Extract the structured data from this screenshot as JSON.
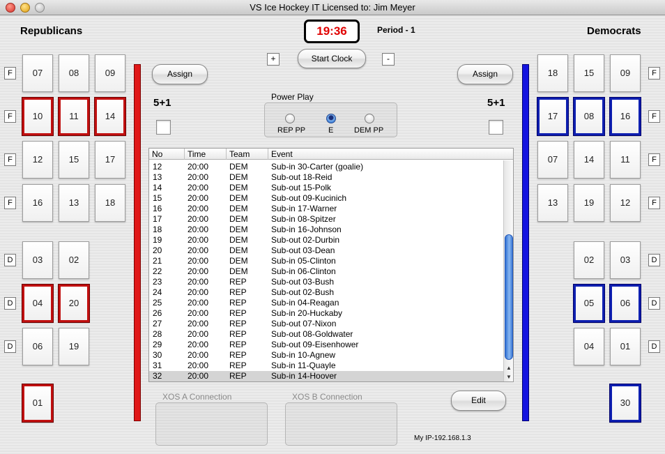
{
  "window": {
    "title": "VS Ice Hockey IT Licensed to: Jim Meyer"
  },
  "teams": {
    "left_name": "Republicans",
    "right_name": "Democrats"
  },
  "clock": {
    "time": "19:36",
    "period": "Period - 1",
    "start_label": "Start Clock",
    "plus": "+",
    "minus": "-"
  },
  "assign_label": "Assign",
  "power_play": {
    "title": "Power Play",
    "left_penalty": "5+1",
    "right_penalty": "5+1",
    "options": [
      "REP PP",
      "E",
      "DEM PP"
    ],
    "selected": "E"
  },
  "left_players": {
    "f1": [
      "07",
      "08",
      "09"
    ],
    "f2": [
      "10",
      "11",
      "14"
    ],
    "f3": [
      "12",
      "15",
      "17"
    ],
    "f4": [
      "16",
      "13",
      "18"
    ],
    "d1": [
      "03",
      "02"
    ],
    "d2": [
      "04",
      "20"
    ],
    "d3": [
      "06",
      "19"
    ],
    "g": "01"
  },
  "right_players": {
    "f1": [
      "18",
      "15",
      "09"
    ],
    "f2": [
      "17",
      "08",
      "16"
    ],
    "f3": [
      "07",
      "14",
      "11"
    ],
    "f4": [
      "13",
      "19",
      "12"
    ],
    "d1": [
      "02",
      "03"
    ],
    "d2": [
      "05",
      "06"
    ],
    "d3": [
      "04",
      "01"
    ],
    "g": "30"
  },
  "position_labels": {
    "forward": "F",
    "defense": "D"
  },
  "table": {
    "columns": [
      "No",
      "Time",
      "Team",
      "Event"
    ],
    "rows": [
      [
        "12",
        "20:00",
        "DEM",
        "Sub-in 30-Carter (goalie)"
      ],
      [
        "13",
        "20:00",
        "DEM",
        "Sub-out 18-Reid"
      ],
      [
        "14",
        "20:00",
        "DEM",
        "Sub-out 15-Polk"
      ],
      [
        "15",
        "20:00",
        "DEM",
        "Sub-out 09-Kucinich"
      ],
      [
        "16",
        "20:00",
        "DEM",
        "Sub-in 17-Warner"
      ],
      [
        "17",
        "20:00",
        "DEM",
        "Sub-in 08-Spitzer"
      ],
      [
        "18",
        "20:00",
        "DEM",
        "Sub-in 16-Johnson"
      ],
      [
        "19",
        "20:00",
        "DEM",
        "Sub-out 02-Durbin"
      ],
      [
        "20",
        "20:00",
        "DEM",
        "Sub-out 03-Dean"
      ],
      [
        "21",
        "20:00",
        "DEM",
        "Sub-in 05-Clinton"
      ],
      [
        "22",
        "20:00",
        "DEM",
        "Sub-in 06-Clinton"
      ],
      [
        "23",
        "20:00",
        "REP",
        "Sub-out 03-Bush"
      ],
      [
        "24",
        "20:00",
        "REP",
        "Sub-out 02-Bush"
      ],
      [
        "25",
        "20:00",
        "REP",
        "Sub-in 04-Reagan"
      ],
      [
        "26",
        "20:00",
        "REP",
        "Sub-in 20-Huckaby"
      ],
      [
        "27",
        "20:00",
        "REP",
        "Sub-out 07-Nixon"
      ],
      [
        "28",
        "20:00",
        "REP",
        "Sub-out 08-Goldwater"
      ],
      [
        "29",
        "20:00",
        "REP",
        "Sub-out 09-Eisenhower"
      ],
      [
        "30",
        "20:00",
        "REP",
        "Sub-in 10-Agnew"
      ],
      [
        "31",
        "20:00",
        "REP",
        "Sub-in 11-Quayle"
      ],
      [
        "32",
        "20:00",
        "REP",
        "Sub-in 14-Hoover"
      ]
    ],
    "selected_row": 20
  },
  "connections": {
    "a_label": "XOS A Connection",
    "b_label": "XOS B Connection"
  },
  "edit_label": "Edit",
  "my_ip": "My IP-192.168.1.3"
}
